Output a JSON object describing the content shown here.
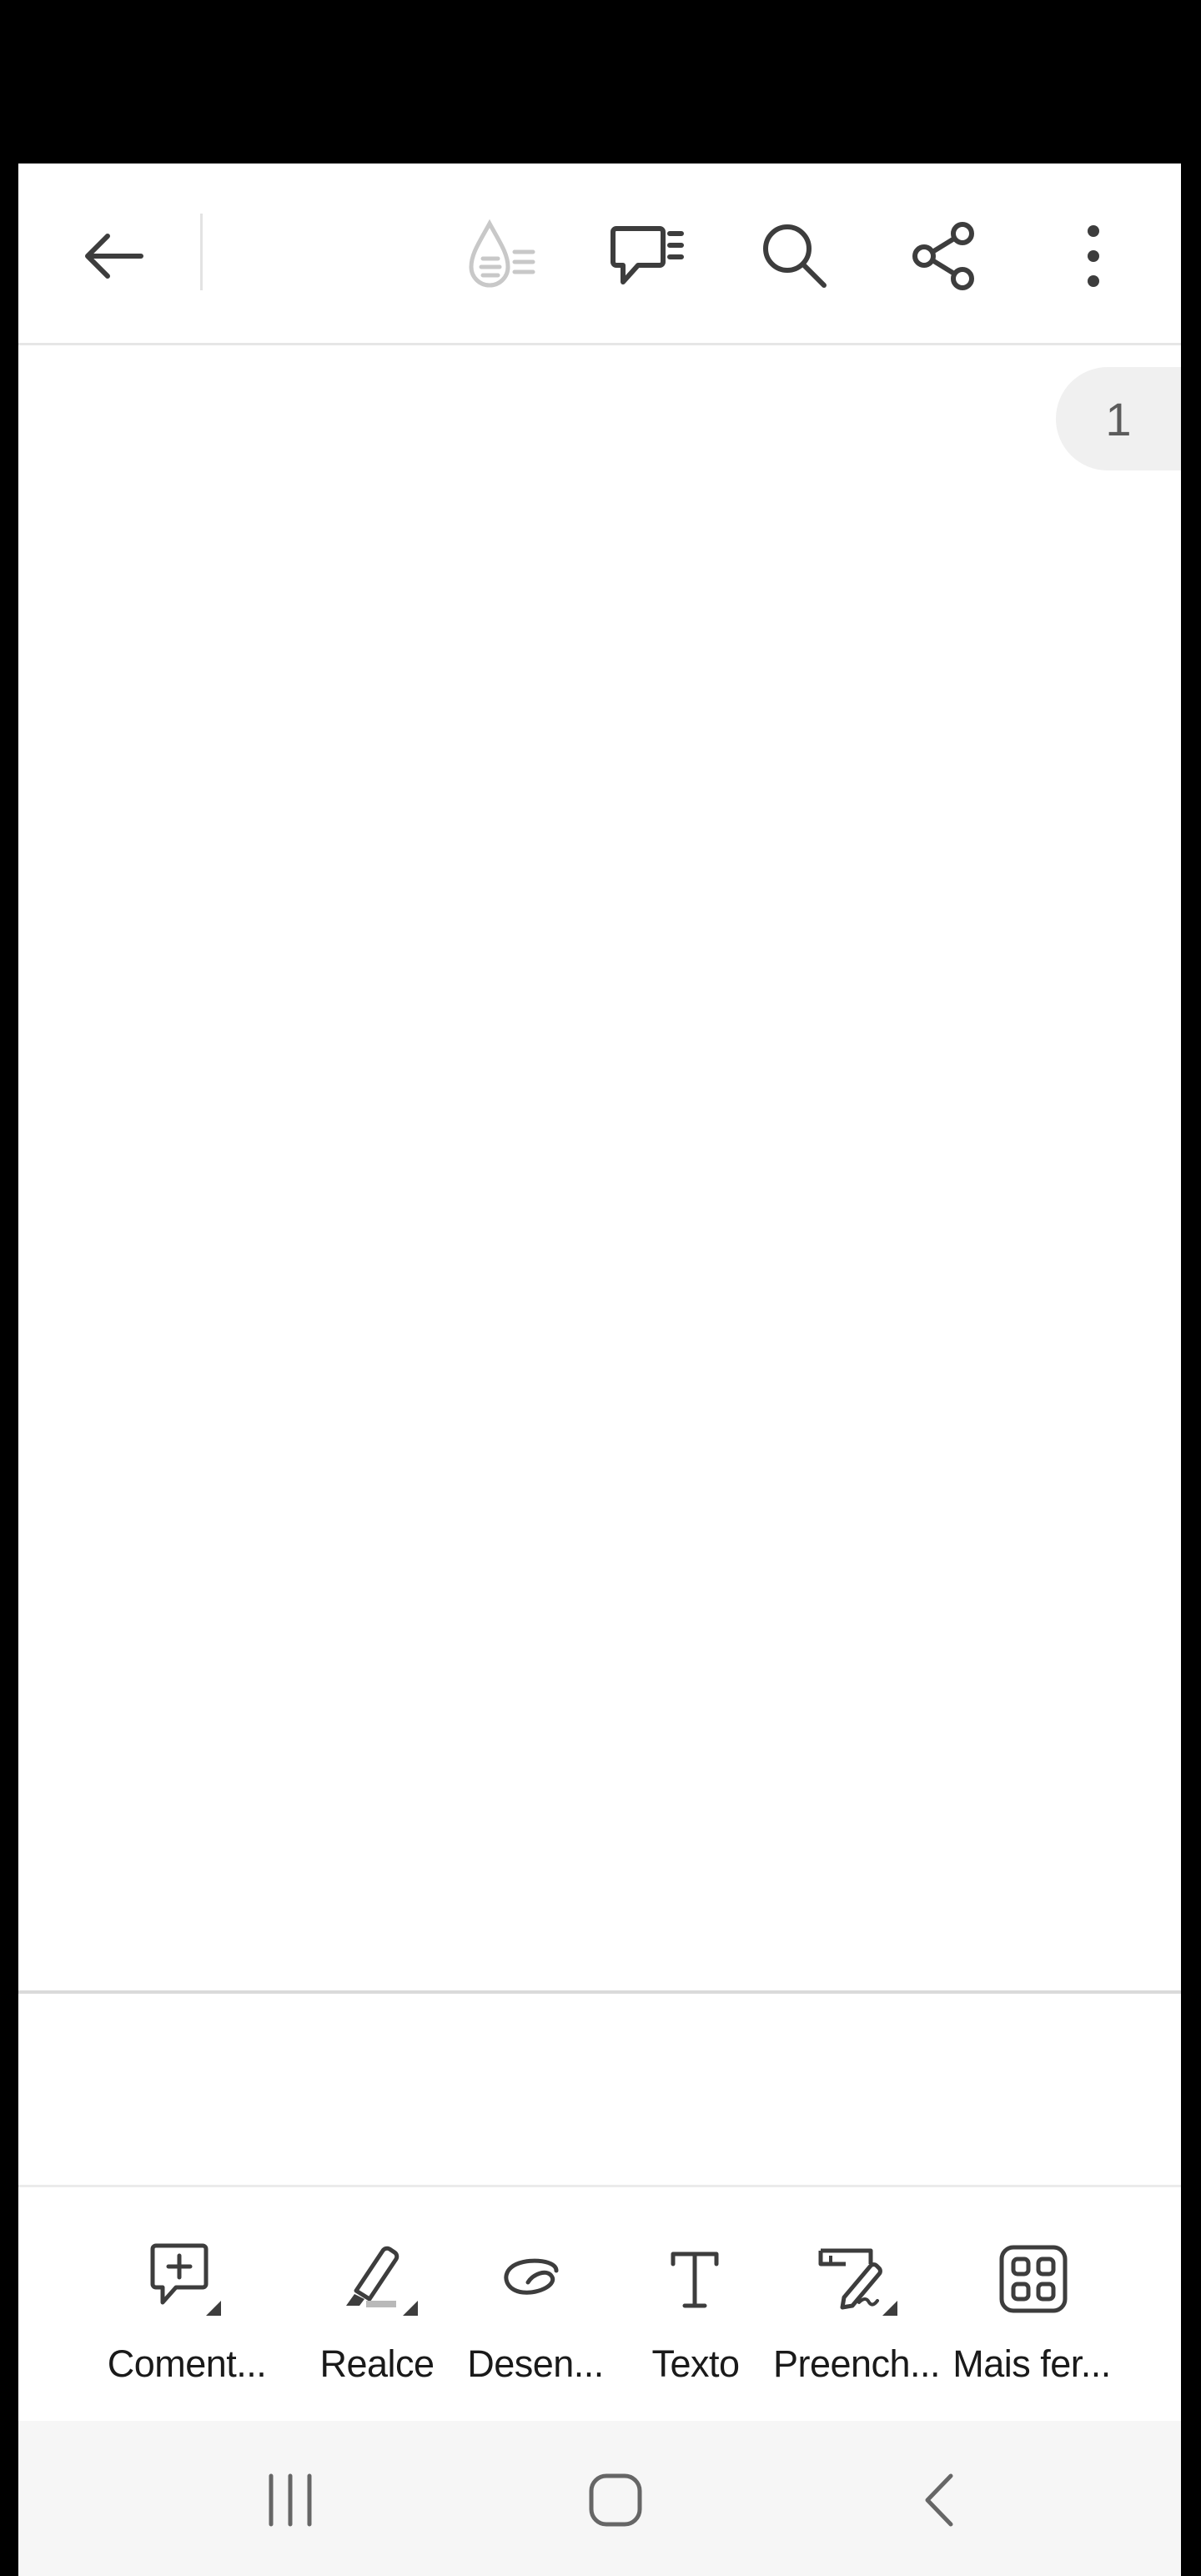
{
  "toolbar": {
    "back": "back-arrow",
    "icons": [
      "liquid-mode-icon",
      "comments-list-icon",
      "search-icon",
      "share-icon",
      "more-options-icon"
    ]
  },
  "document": {
    "page_number": "1"
  },
  "bottom_tools": [
    {
      "label": "Coment...",
      "icon": "add-comment-icon"
    },
    {
      "label": "Realce",
      "icon": "highlighter-icon"
    },
    {
      "label": "Desen...",
      "icon": "draw-icon"
    },
    {
      "label": "Texto",
      "icon": "text-icon"
    },
    {
      "label": "Preench...",
      "icon": "fill-sign-icon"
    },
    {
      "label": "Mais fer...",
      "icon": "more-tools-icon"
    }
  ],
  "system_nav": [
    "recent-apps",
    "home",
    "back"
  ],
  "colors": {
    "icon_dark": "#3d3d3d",
    "icon_disabled": "#c8c8c8",
    "page_badge_bg": "#f0f0f0",
    "nav_bg": "#f6f6f6"
  }
}
